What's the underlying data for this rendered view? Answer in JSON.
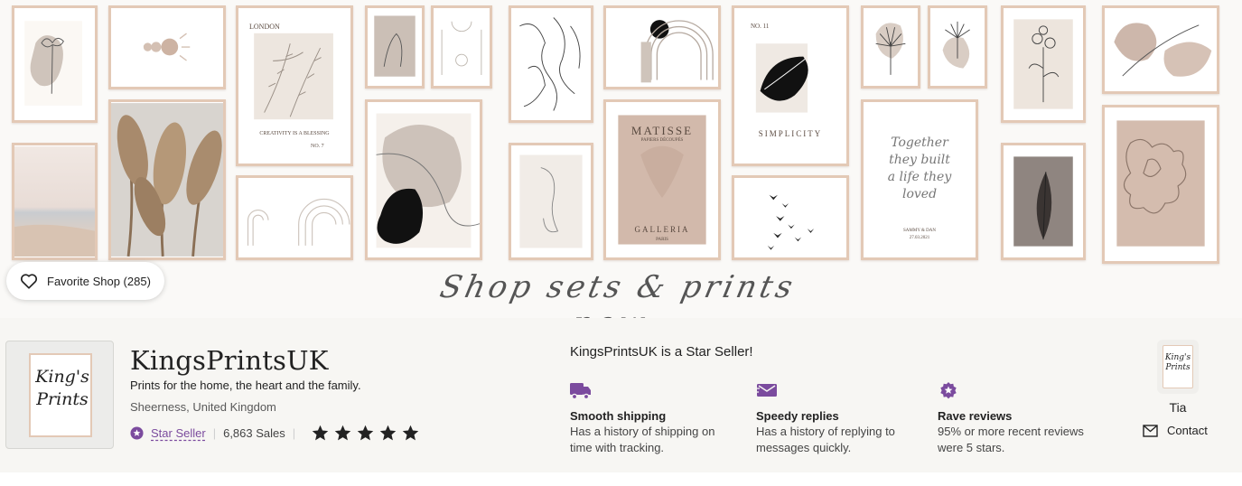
{
  "banner": {
    "caption": "Shop sets & prints now",
    "favorite_label": "Favorite Shop (285)",
    "prints": {
      "london": {
        "title": "LONDON",
        "footer": "CREATIVITY IS A BLESSING",
        "num": "NO. 7"
      },
      "matisse": {
        "title": "MATISSE",
        "sub": "PAPIERS DÉCOUPÉS",
        "footer": "GALLERIA",
        "city": "PARIS"
      },
      "simplicity": {
        "num": "NO. 11",
        "title": "SIMPLICITY"
      },
      "together": {
        "quote": "Together they built a life they loved",
        "names": "SAMMY & DAN",
        "date": "27.03.2021"
      }
    }
  },
  "shop": {
    "logo_text": "King's Prints",
    "name": "KingsPrintsUK",
    "tagline": "Prints for the home, the heart and the family.",
    "location": "Sheerness, United Kingdom",
    "star_seller_label": "Star Seller",
    "sales": "6,863 Sales",
    "rating": 5
  },
  "star_seller": {
    "title": "KingsPrintsUK is a Star Seller!",
    "features": [
      {
        "icon": "truck-icon",
        "title": "Smooth shipping",
        "desc": "Has a history of shipping on time with tracking."
      },
      {
        "icon": "message-icon",
        "title": "Speedy replies",
        "desc": "Has a history of replying to messages quickly."
      },
      {
        "icon": "star-badge-icon",
        "title": "Rave reviews",
        "desc": "95% or more recent reviews were 5 stars."
      }
    ]
  },
  "owner": {
    "avatar_text": "King's Prints",
    "name": "Tia",
    "contact_label": "Contact"
  },
  "colors": {
    "accent_purple": "#7b4b9e",
    "frame_wood": "#e3c9b6",
    "panel_bg": "#f7f6f3"
  }
}
